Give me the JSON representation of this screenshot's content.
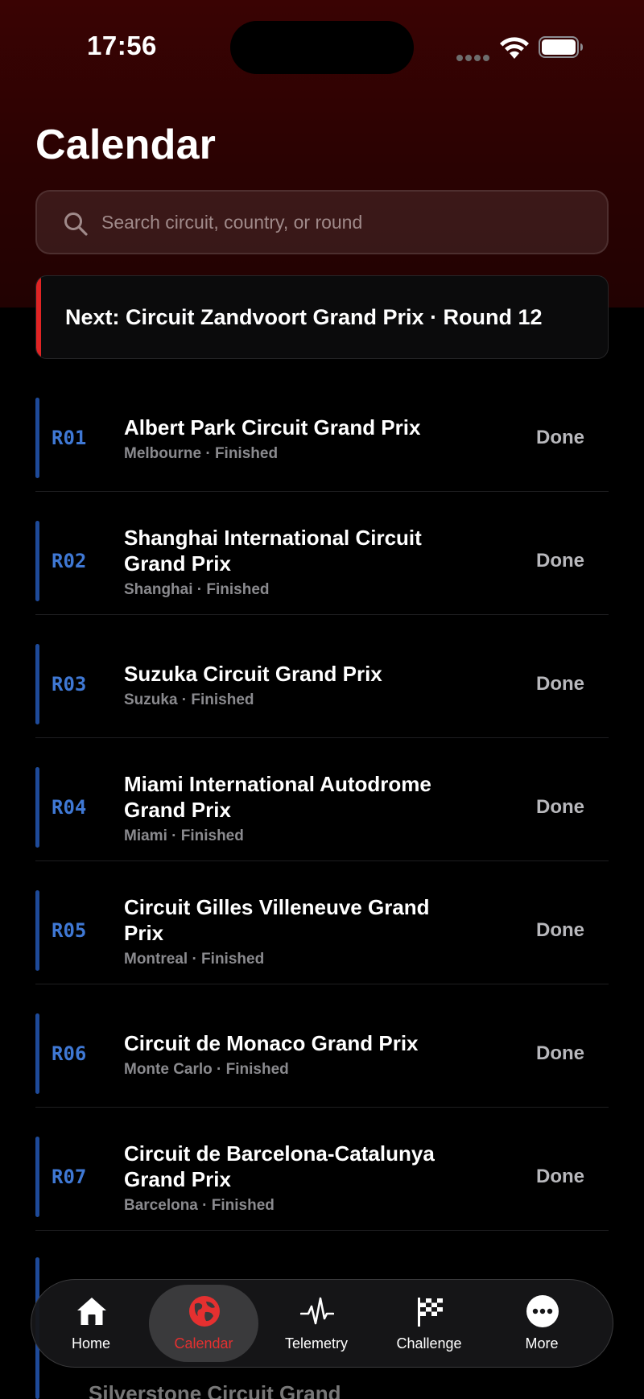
{
  "status_bar": {
    "time": "17:56"
  },
  "header": {
    "title": "Calendar"
  },
  "search": {
    "placeholder": "Search circuit, country, or round"
  },
  "next_banner": {
    "text": "Next: Circuit Zandvoort Grand Prix · Round 12"
  },
  "colors": {
    "accent": "#e02424",
    "round_code": "#3f78d4",
    "row_accent": "#1e4a99"
  },
  "races": [
    {
      "round": "R01",
      "name": "Albert Park Circuit Grand Prix",
      "subtitle": "Melbourne · Finished",
      "status": "Done"
    },
    {
      "round": "R02",
      "name": "Shanghai International Circuit Grand Prix",
      "subtitle": "Shanghai · Finished",
      "status": "Done"
    },
    {
      "round": "R03",
      "name": "Suzuka Circuit Grand Prix",
      "subtitle": "Suzuka · Finished",
      "status": "Done"
    },
    {
      "round": "R04",
      "name": "Miami International Autodrome Grand Prix",
      "subtitle": "Miami · Finished",
      "status": "Done"
    },
    {
      "round": "R05",
      "name": "Circuit Gilles Villeneuve Grand Prix",
      "subtitle": "Montreal · Finished",
      "status": "Done"
    },
    {
      "round": "R06",
      "name": "Circuit de Monaco Grand Prix",
      "subtitle": "Monte Carlo · Finished",
      "status": "Done"
    },
    {
      "round": "R07",
      "name": "Circuit de Barcelona-Catalunya Grand Prix",
      "subtitle": "Barcelona · Finished",
      "status": "Done"
    }
  ],
  "peek": {
    "name": "Silverstone Circuit Grand"
  },
  "tabs": [
    {
      "label": "Home",
      "icon": "house-icon",
      "active": false
    },
    {
      "label": "Calendar",
      "icon": "globe-icon",
      "active": true
    },
    {
      "label": "Telemetry",
      "icon": "waveform-icon",
      "active": false
    },
    {
      "label": "Challenge",
      "icon": "checkered-flag-icon",
      "active": false
    },
    {
      "label": "More",
      "icon": "ellipsis-circle-icon",
      "active": false
    }
  ]
}
